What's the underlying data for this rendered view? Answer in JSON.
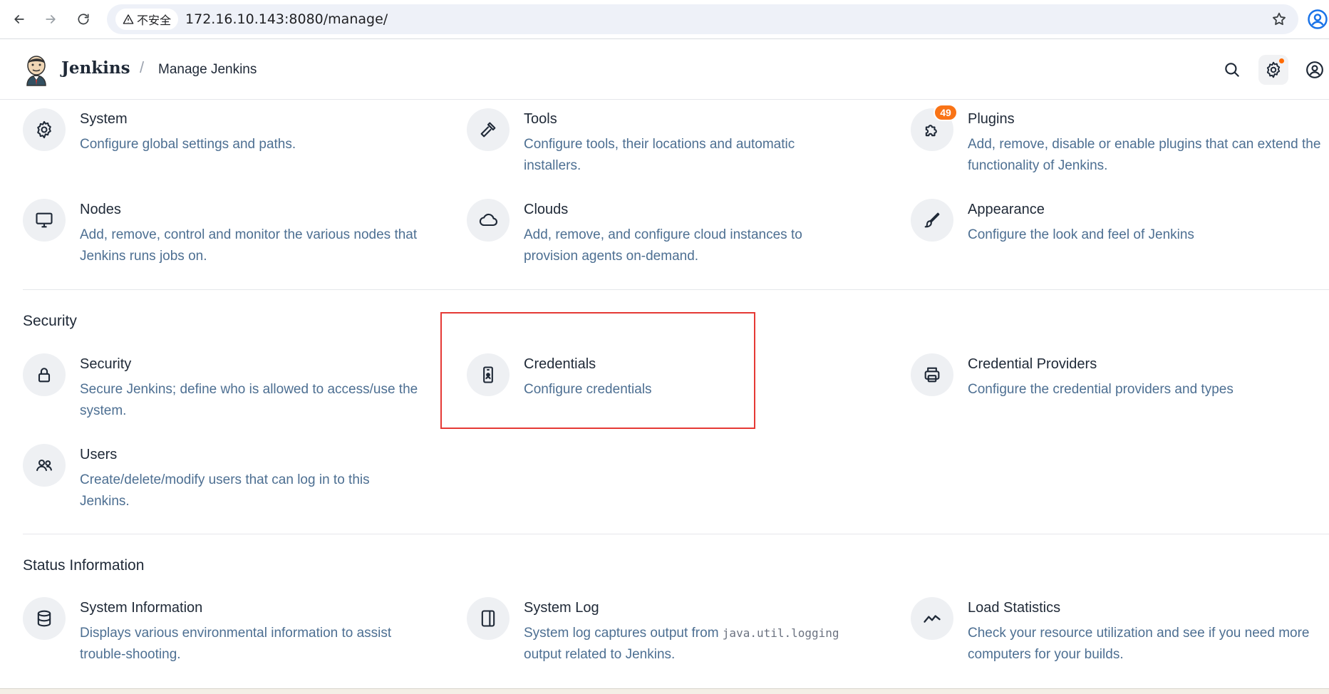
{
  "browser": {
    "insecure_label": "不安全",
    "url": "172.16.10.143:8080/manage/"
  },
  "header": {
    "brand": "Jenkins",
    "separator": "/",
    "breadcrumb": "Manage Jenkins"
  },
  "system_config": {
    "tiles": [
      {
        "title": "System",
        "desc": "Configure global settings and paths.",
        "icon": "gear-icon"
      },
      {
        "title": "Tools",
        "desc": "Configure tools, their locations and automatic installers.",
        "icon": "hammer-icon"
      },
      {
        "title": "Plugins",
        "desc": "Add, remove, disable or enable plugins that can extend the functionality of Jenkins.",
        "icon": "puzzle-icon",
        "badge": "49"
      },
      {
        "title": "Nodes",
        "desc": "Add, remove, control and monitor the various nodes that Jenkins runs jobs on.",
        "icon": "monitor-icon"
      },
      {
        "title": "Clouds",
        "desc": "Add, remove, and configure cloud instances to provision agents on-demand.",
        "icon": "cloud-icon"
      },
      {
        "title": "Appearance",
        "desc": "Configure the look and feel of Jenkins",
        "icon": "brush-icon"
      }
    ]
  },
  "security": {
    "heading": "Security",
    "tiles": [
      {
        "title": "Security",
        "desc": "Secure Jenkins; define who is allowed to access/use the system.",
        "icon": "lock-icon"
      },
      {
        "title": "Credentials",
        "desc": "Configure credentials",
        "icon": "credentials-icon"
      },
      {
        "title": "Credential Providers",
        "desc": "Configure the credential providers and types",
        "icon": "printer-icon"
      },
      {
        "title": "Users",
        "desc": "Create/delete/modify users that can log in to this Jenkins.",
        "icon": "users-icon"
      }
    ]
  },
  "status": {
    "heading": "Status Information",
    "tiles": [
      {
        "title": "System Information",
        "desc": "Displays various environmental information to assist trouble-shooting.",
        "icon": "database-icon"
      },
      {
        "title": "System Log",
        "desc_before": "System log captures output from ",
        "desc_code": "java.util.logging",
        "desc_after": " output related to Jenkins.",
        "icon": "log-icon"
      },
      {
        "title": "Load Statistics",
        "desc": "Check your resource utilization and see if you need more computers for your builds.",
        "icon": "activity-icon"
      }
    ]
  },
  "colors": {
    "desc_text": "#4d6f92",
    "badge": "#f97316",
    "highlight": "#e53935"
  }
}
